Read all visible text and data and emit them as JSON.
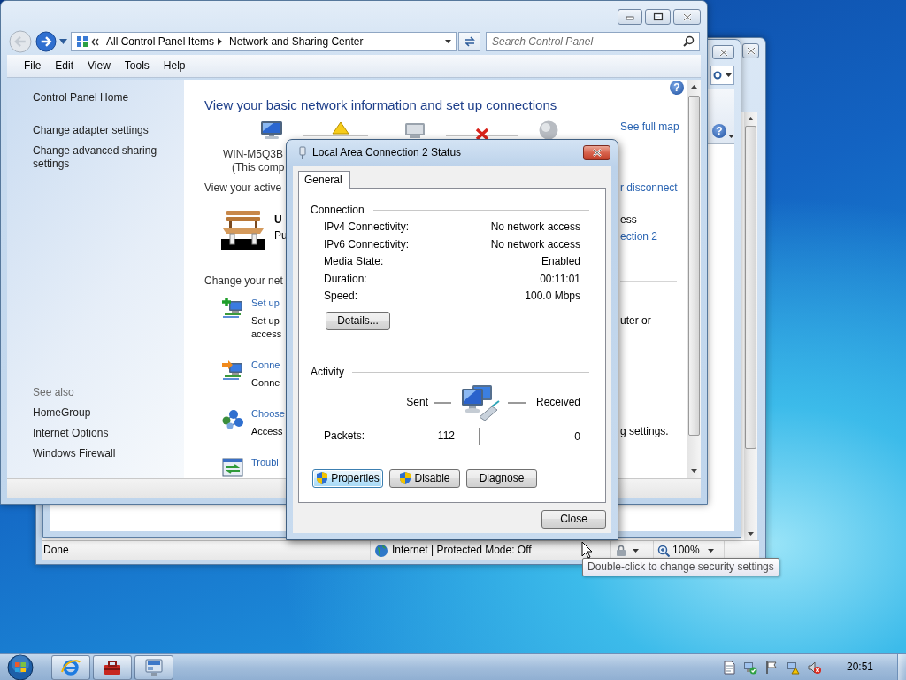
{
  "browser_window": {
    "status": "Done",
    "zone": "Internet | Protected Mode: Off",
    "zoom": "100%",
    "tooltip": "Double-click to change security settings"
  },
  "explorer_window": {
    "help": "?"
  },
  "control_panel": {
    "nav": {
      "back_enabled": false,
      "forward_enabled": true
    },
    "address": {
      "segments": [
        "All Control Panel Items",
        "Network and Sharing Center"
      ]
    },
    "search": {
      "placeholder": "Search Control Panel"
    },
    "menu": [
      {
        "label": "File"
      },
      {
        "label": "Edit"
      },
      {
        "label": "View"
      },
      {
        "label": "Tools"
      },
      {
        "label": "Help"
      }
    ],
    "sidebar": {
      "links": [
        "Control Panel Home",
        "Change adapter settings",
        "Change advanced sharing settings"
      ],
      "see_also_title": "See also",
      "see_also": [
        "HomeGroup",
        "Internet Options",
        "Windows Firewall"
      ]
    },
    "main": {
      "help": "?",
      "heading": "View your basic network information and set up connections",
      "see_full_map": "See full map",
      "computer_name": "WIN-M5Q3B",
      "computer_note": "(This comp",
      "active_heading": "View your active",
      "active_link": "r disconnect",
      "network_name": "U",
      "network_type": "Pu",
      "access_text": "ess",
      "connection_link": "ection 2",
      "change_heading": "Change your net",
      "tasks": [
        {
          "kind": "setup",
          "link": "Set up",
          "lines": [
            "Set up",
            "access"
          ],
          "right_text": "uter or"
        },
        {
          "kind": "connect",
          "link": "Conne",
          "lines": [
            "Conne"
          ]
        },
        {
          "kind": "homegroup",
          "link": "Choose",
          "lines": [
            "Access"
          ],
          "right_text": "g settings."
        },
        {
          "kind": "troubleshoot",
          "link": "Troubl"
        }
      ]
    }
  },
  "dialog": {
    "title": "Local Area Connection 2 Status",
    "tabs": [
      {
        "label": "General",
        "selected": true
      }
    ],
    "connection": {
      "heading": "Connection",
      "rows": [
        {
          "label": "IPv4 Connectivity:",
          "value": "No network access"
        },
        {
          "label": "IPv6 Connectivity:",
          "value": "No network access"
        },
        {
          "label": "Media State:",
          "value": "Enabled"
        },
        {
          "label": "Duration:",
          "value": "00:11:01"
        },
        {
          "label": "Speed:",
          "value": "100.0 Mbps"
        }
      ]
    },
    "details_button": {
      "label": "Details..."
    },
    "activity": {
      "heading": "Activity",
      "sent": "Sent",
      "received": "Received",
      "packets_label": "Packets:",
      "packets_sent": "112",
      "packets_received": "0"
    },
    "buttons": [
      {
        "label": "Properties",
        "shield": true,
        "focused": true
      },
      {
        "label": "Disable",
        "shield": true,
        "focused": false
      },
      {
        "label": "Diagnose",
        "shield": false,
        "focused": false
      }
    ],
    "close_button": {
      "label": "Close"
    }
  },
  "taskbar": {
    "buttons": [
      {
        "kind": "browser"
      },
      {
        "kind": "toolbox"
      },
      {
        "kind": "monitor"
      }
    ],
    "tray": [
      {
        "kind": "document"
      },
      {
        "kind": "network-ok"
      },
      {
        "kind": "flag"
      },
      {
        "kind": "network-warning"
      },
      {
        "kind": "speaker-muted"
      }
    ],
    "clock": "20:51"
  }
}
